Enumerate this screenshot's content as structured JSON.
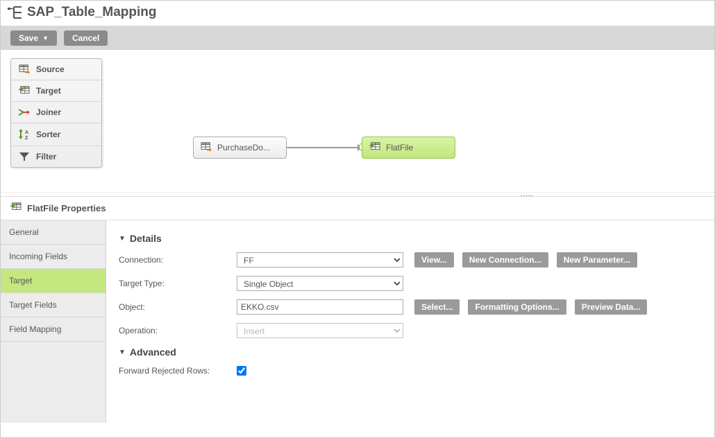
{
  "title": "SAP_Table_Mapping",
  "actions": {
    "save": "Save",
    "cancel": "Cancel"
  },
  "palette": [
    {
      "label": "Source",
      "icon": "source-icon"
    },
    {
      "label": "Target",
      "icon": "target-icon"
    },
    {
      "label": "Joiner",
      "icon": "joiner-icon"
    },
    {
      "label": "Sorter",
      "icon": "sorter-icon"
    },
    {
      "label": "Filter",
      "icon": "filter-icon"
    }
  ],
  "canvas": {
    "source_label": "PurchaseDo...",
    "target_label": "FlatFile"
  },
  "properties": {
    "header": "FlatFile Properties",
    "tabs": [
      "General",
      "Incoming Fields",
      "Target",
      "Target Fields",
      "Field Mapping"
    ],
    "active_tab": "Target",
    "details_heading": "Details",
    "advanced_heading": "Advanced",
    "connection": {
      "label": "Connection:",
      "value": "FF"
    },
    "target_type": {
      "label": "Target Type:",
      "value": "Single Object"
    },
    "object": {
      "label": "Object:",
      "value": "EKKO.csv"
    },
    "operation": {
      "label": "Operation:",
      "value": "Insert"
    },
    "forward_rejected": {
      "label": "Forward Rejected Rows:",
      "checked": true
    },
    "buttons": {
      "view": "View...",
      "new_connection": "New Connection...",
      "new_parameter": "New Parameter...",
      "select": "Select...",
      "formatting": "Formatting Options...",
      "preview": "Preview Data..."
    }
  }
}
